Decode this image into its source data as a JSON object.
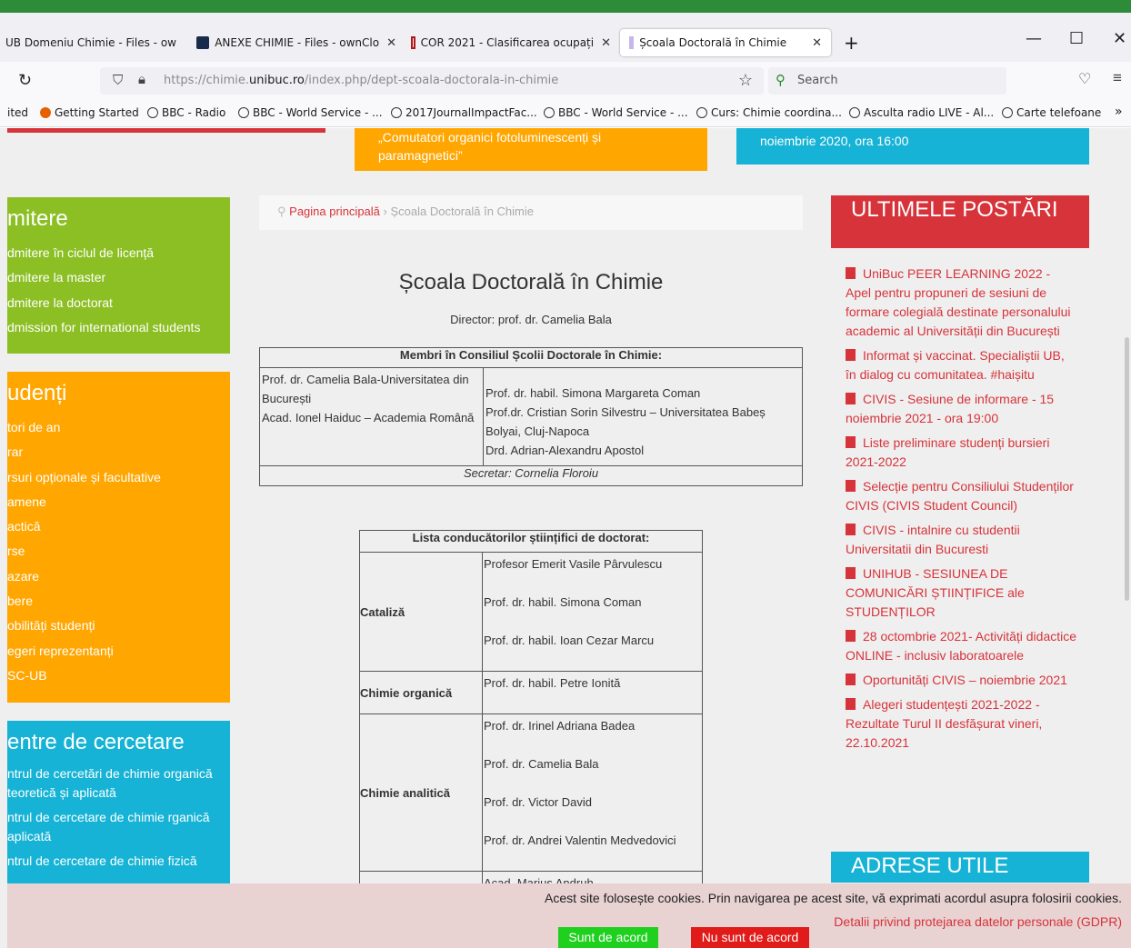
{
  "browser": {
    "tabs": [
      {
        "label": "UB Domeniu Chimie - Files - ow"
      },
      {
        "label": "ANEXE CHIMIE - Files - ownClo"
      },
      {
        "label": "COR 2021 - Clasificarea ocupați"
      },
      {
        "label": "Școala Doctorală în Chimie"
      }
    ],
    "new_tab": "+",
    "url_prefix": "https://chimie.",
    "url_domain": "unibuc.ro",
    "url_path": "/index.php/dept-scoala-doctorala-in-chimie",
    "search_placeholder": "Search",
    "bookmarks": [
      "ited",
      "Getting Started",
      "BBC - Radio",
      "BBC - World Service - ...",
      "2017JournalImpactFac...",
      "BBC - World Service - ...",
      "Curs: Chimie coordina...",
      "Asculta radio LIVE - Al...",
      "Carte telefoane"
    ]
  },
  "banners": {
    "orange_text": "„Comutatori organici fotoluminescenți și paramagnetici”",
    "blue_text": "noiembrie 2020, ora 16:00"
  },
  "sidebar": {
    "admitere": {
      "title": "mitere",
      "items": [
        "dmitere în ciclul de licență",
        "dmitere la master",
        "dmitere la doctorat",
        "dmission for international students"
      ]
    },
    "studenti": {
      "title": "udenți",
      "items": [
        "tori de an",
        "rar",
        "rsuri opționale și facultative",
        "amene",
        "actică",
        "rse",
        "azare",
        "bere",
        "obilități studenți",
        "egeri reprezentanți",
        "SC-UB"
      ]
    },
    "centre": {
      "title": "entre de cercetare",
      "items": [
        "ntrul de cercetări de chimie organică teoretică și aplicată",
        "ntrul de cercetare de chimie rganică aplicată",
        "ntrul de cercetare de chimie fizică"
      ]
    }
  },
  "breadcrumb": {
    "home": "Pagina principală",
    "sep": "›",
    "current": "Școala Doctorală în Chimie"
  },
  "main": {
    "title": "Școala Doctorală în Chimie",
    "director": "Director: prof. dr. Camelia Bala",
    "council": {
      "header": "Membri în Consiliul Școlii Doctorale în Chimie:",
      "left": [
        "Prof. dr. Camelia Bala-Universitatea din București",
        "Acad. Ionel Haiduc – Academia Română"
      ],
      "right": [
        "Prof. dr. habil. Simona Margareta Coman",
        "Prof.dr. Cristian Sorin Silvestru – Universitatea Babeș Bolyai, Cluj-Napoca",
        "Drd. Adrian-Alexandru Apostol"
      ],
      "secretary": "Secretar: Cornelia Floroiu"
    },
    "supervisors": {
      "header": "Lista conducătorilor științifici de doctorat:",
      "groups": [
        {
          "category": "Cataliză",
          "people": [
            "Profesor Emerit Vasile Pârvulescu",
            "Prof. dr. habil. Simona Coman",
            "Prof. dr. habil. Ioan Cezar Marcu"
          ]
        },
        {
          "category": "Chimie organică",
          "people": [
            "Prof. dr. habil. Petre Ionită"
          ]
        },
        {
          "category": "Chimie analitică",
          "people": [
            "Prof. dr. Irinel Adriana Badea",
            "Prof. dr. Camelia Bala",
            "Prof. dr. Victor David",
            "Prof. dr. Andrei Valentin Medvedovici"
          ]
        },
        {
          "category": "",
          "people": [
            "Acad. Marius Andruh"
          ]
        }
      ]
    }
  },
  "right_col": {
    "posts_title": "ULTIMELE POSTĂRI",
    "posts": [
      "UniBuc PEER LEARNING 2022 - Apel pentru propuneri de sesiuni de formare colegială destinate personalului academic al Universității din București",
      "Informat și vaccinat. Specialiștii UB, în dialog cu comunitatea. #haișitu",
      "CIVIS - Sesiune de informare - 15 noiembrie 2021 - ora 19:00",
      "Liste preliminare studenți bursieri 2021-2022",
      "Selecție pentru Consiliului Studenților CIVIS (CIVIS Student Council)",
      "CIVIS - intalnire cu studentii Universitatii din Bucuresti",
      "UNIHUB - SESIUNEA DE COMUNICĂRI ȘTIINȚIFICE ale STUDENȚILOR",
      "28 octombrie 2021- Activități didactice ONLINE - inclusiv laboratoarele",
      "Oportunități CIVIS – noiembrie 2021",
      "Alegeri studențești 2021-2022 - Rezultate Turul II desfășurat vineri, 22.10.2021"
    ],
    "links_title": "ADRESE UTILE"
  },
  "cookie": {
    "message": "Acest site folosește cookies. Prin navigarea pe acest site, vă exprimati acordul asupra folosirii cookies.",
    "link": "Detalii privind protejarea datelor personale (GDPR)",
    "accept": "Sunt de acord",
    "decline": "Nu sunt de acord"
  },
  "colors": {
    "red": "#d7333a",
    "orange": "#ffa600",
    "green": "#8bbf23",
    "cyan": "#16b3d6"
  }
}
